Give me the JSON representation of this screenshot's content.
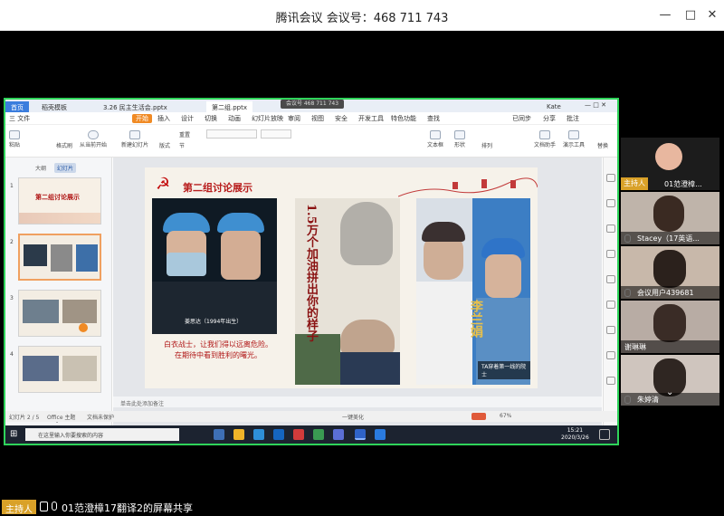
{
  "window": {
    "title": "腾讯会议 会议号：468 711 743"
  },
  "wps": {
    "tabs": [
      "首页",
      "稻壳模板",
      "3.26 民主生活会.pptx",
      "第二组.pptx"
    ],
    "user": "Kate",
    "menu": [
      "三 文件",
      "开始",
      "插入",
      "设计",
      "切换",
      "动画",
      "幻灯片放映",
      "审阅",
      "视图",
      "安全",
      "开发工具",
      "特色功能",
      "查找"
    ],
    "menu_right": [
      "已同步",
      "分享",
      "批注"
    ],
    "ribbon_labels": [
      "粘贴",
      "格式刷",
      "从当前开始",
      "新建幻灯片",
      "版式",
      "节",
      "重置",
      "文本框",
      "形状",
      "排列",
      "文档助手",
      "演示工具",
      "替换"
    ],
    "left_tabs": [
      "大纲",
      "幻灯片"
    ],
    "slide_numbers": [
      "1",
      "2",
      "3",
      "4"
    ],
    "thumb1_title": "第二组讨论展示",
    "notes_placeholder": "单击此处添加备注",
    "status": {
      "slide": "幻灯片 2 / 5",
      "theme": "Office 主题",
      "protect": "文档未保护",
      "beautify": "一键美化",
      "zoom": "67%"
    }
  },
  "slide": {
    "title": "第二组讨论展示",
    "photo1_caption": "姜思达（1994年出生）",
    "red_caption_line1": "白衣战士，让我们得以远离危险。",
    "red_caption_line2": "在期待中看到胜利的曙光。",
    "vertical_text": "1.5万个加油拼出你的样子",
    "name_vertical": "李兰娟",
    "photo3_caption": "TA穿着第一线的院士"
  },
  "taskbar": {
    "search_placeholder": "在这里输入你要搜索的内容",
    "time": "15:21",
    "date": "2020/3/26"
  },
  "participants": [
    {
      "name": "01范澄樟...",
      "host": true,
      "host_label": "主持人"
    },
    {
      "name": "Stacey（17英语...",
      "host": false
    },
    {
      "name": "会议用户439681",
      "host": false
    },
    {
      "name": "谢琳琳",
      "host": false
    },
    {
      "name": "朱婷清",
      "host": false
    }
  ],
  "bottom": {
    "host_label": "主持人",
    "share_text": "01范澄樟17翻译2的屏幕共享"
  }
}
